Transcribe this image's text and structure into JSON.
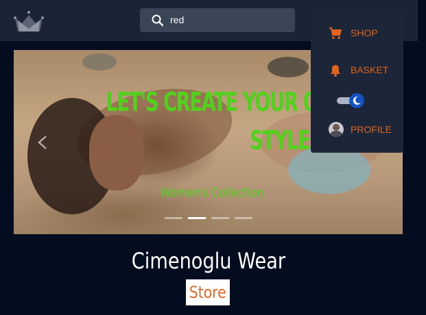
{
  "header": {
    "logo_icon": "crown-icon",
    "search": {
      "value": "red",
      "icon": "search-icon"
    }
  },
  "hero": {
    "title_line1": "LET'S CREATE YOUR OWN",
    "title_line2": "STYLE",
    "subtitle": "Women's Collection",
    "prev_icon": "chevron-left-icon",
    "slides": 4,
    "active_slide": 2,
    "accent": "#52d11c"
  },
  "brand": {
    "name": "Cimenoglu Wear",
    "tag": "Store",
    "tag_color": "#e06a25"
  },
  "menu": {
    "items": [
      {
        "label": "SHOP",
        "icon": "cart-icon"
      },
      {
        "label": "BASKET",
        "icon": "bell-icon"
      },
      {
        "label": "PROFILE",
        "icon": "avatar"
      }
    ],
    "theme_toggle": {
      "icon": "moon-icon",
      "state": "dark"
    },
    "accent": "#e0641e"
  }
}
